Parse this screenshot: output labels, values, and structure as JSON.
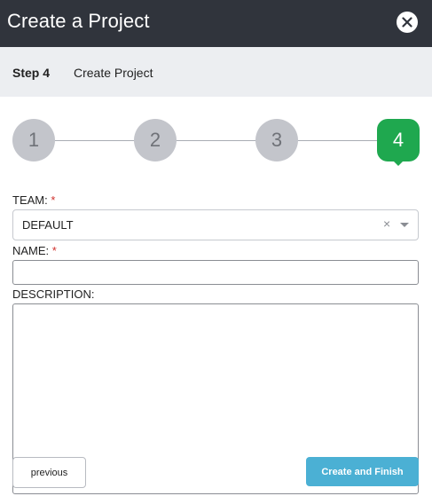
{
  "dialog": {
    "title": "Create a Project",
    "close_icon": "close-icon"
  },
  "step_header": {
    "step_label": "Step 4",
    "step_name": "Create Project"
  },
  "stepper": {
    "steps": [
      "1",
      "2",
      "3",
      "4"
    ],
    "active_step": "4",
    "colors": {
      "inactive": "#c3c5cb",
      "active": "#1fa84f"
    }
  },
  "form": {
    "team": {
      "label": "TEAM:",
      "required_mark": "*",
      "selected_value": "DEFAULT",
      "clear_glyph": "×"
    },
    "name": {
      "label": "NAME:",
      "required_mark": "*",
      "value": ""
    },
    "description": {
      "label": "DESCRIPTION:",
      "value": ""
    }
  },
  "actions": {
    "previous_label": "previous",
    "finish_label": "Create and Finish",
    "finish_color": "#4bb0d4"
  },
  "colors": {
    "header_bg": "#30343c",
    "stepbar_bg": "#eceef1",
    "required": "#d0312d"
  }
}
